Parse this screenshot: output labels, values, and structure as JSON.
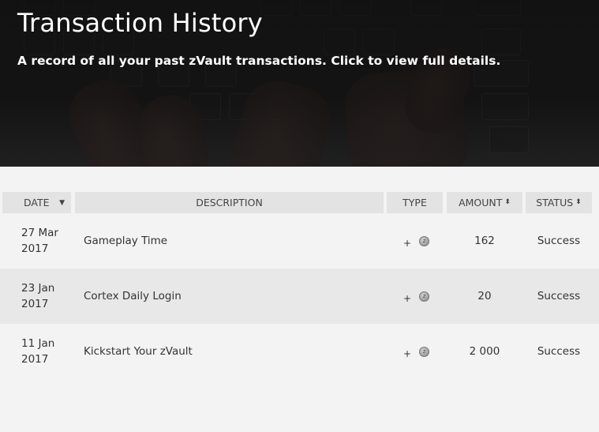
{
  "header": {
    "title": "Transaction History",
    "subtitle": "A record of all your past zVault transactions. Click to view full details."
  },
  "table": {
    "columns": [
      {
        "label": "DATE",
        "sort": "▼"
      },
      {
        "label": "DESCRIPTION"
      },
      {
        "label": "TYPE"
      },
      {
        "label": "AMOUNT",
        "sort": "⬍"
      },
      {
        "label": "STATUS",
        "sort": "⬍"
      }
    ],
    "rows": [
      {
        "date_day": "27 Mar",
        "date_year": "2017",
        "description": "Gameplay Time",
        "type_sign": "+",
        "type_icon": "z-coin-icon",
        "amount": "162",
        "status": "Success"
      },
      {
        "date_day": "23 Jan",
        "date_year": "2017",
        "description": "Cortex Daily Login",
        "type_sign": "+",
        "type_icon": "z-coin-icon",
        "amount": "20",
        "status": "Success"
      },
      {
        "date_day": "11 Jan",
        "date_year": "2017",
        "description": "Kickstart Your zVault",
        "type_sign": "+",
        "type_icon": "z-coin-icon",
        "amount": "2 000",
        "status": "Success"
      }
    ]
  }
}
